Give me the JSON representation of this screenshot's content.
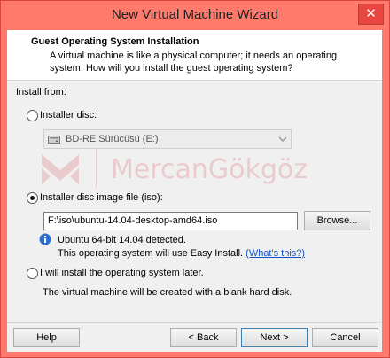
{
  "window": {
    "title": "New Virtual Machine Wizard",
    "close_glyph": "✕"
  },
  "header": {
    "title": "Guest Operating System Installation",
    "subtitle": "A virtual machine is like a physical computer; it needs an operating system. How will you install the guest operating system?"
  },
  "install_from_label": "Install from:",
  "options": {
    "disc": {
      "label": "Installer disc:",
      "selected": false,
      "drive": "BD-RE Sürücüsü (E:)"
    },
    "iso": {
      "label": "Installer disc image file (iso):",
      "selected": true,
      "path": "F:\\iso\\ubuntu-14.04-desktop-amd64.iso",
      "browse_label": "Browse..."
    },
    "detection": {
      "line1": "Ubuntu 64-bit 14.04 detected.",
      "line2": "This operating system will use Easy Install.",
      "link": "(What's this?)"
    },
    "later": {
      "label": "I will install the operating system later.",
      "selected": false,
      "note": "The virtual machine will be created with a blank hard disk."
    }
  },
  "watermark": {
    "text": "MercanGökgöz"
  },
  "footer": {
    "help": "Help",
    "back": "< Back",
    "next": "Next >",
    "cancel": "Cancel"
  }
}
